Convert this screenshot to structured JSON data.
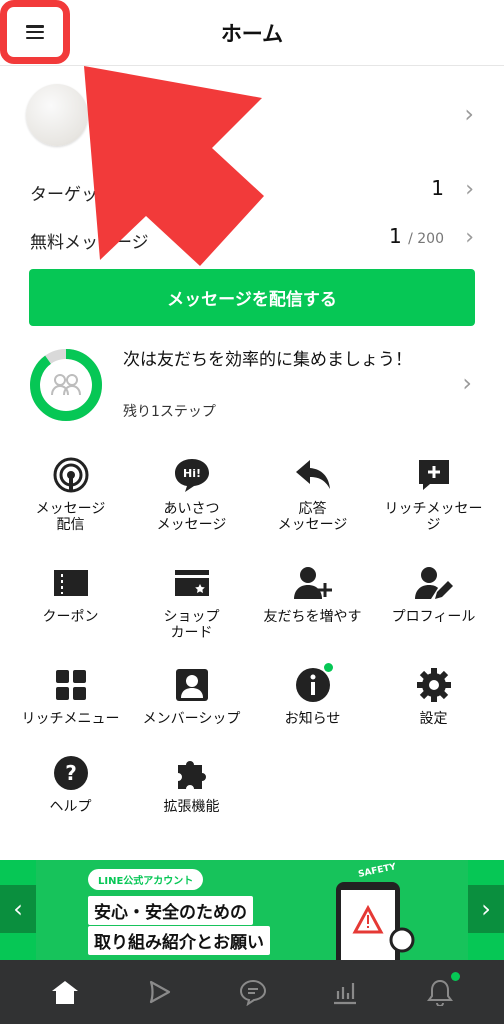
{
  "header": {
    "title": "ホーム"
  },
  "stats": [
    {
      "label": "ターゲットリーチ",
      "value": "1",
      "suffix": ""
    },
    {
      "label": "無料メッセージ",
      "value": "1",
      "suffix": "/ 200"
    }
  ],
  "cta_label": "メッセージを配信する",
  "progress": {
    "text": "次は友だちを効率的に集めましょう！",
    "sub": "残り1ステップ",
    "fraction": 0.9
  },
  "tiles": [
    {
      "label": "メッセージ\n配信",
      "icon": "broadcast-icon"
    },
    {
      "label": "あいさつ\nメッセージ",
      "icon": "greeting-icon"
    },
    {
      "label": "応答\nメッセージ",
      "icon": "reply-icon"
    },
    {
      "label": "リッチメッセー\nジ",
      "icon": "rich-message-icon"
    },
    {
      "label": "クーポン",
      "icon": "coupon-icon"
    },
    {
      "label": "ショップ\nカード",
      "icon": "shop-card-icon"
    },
    {
      "label": "友だちを増やす",
      "icon": "add-friend-icon"
    },
    {
      "label": "プロフィール",
      "icon": "profile-edit-icon"
    },
    {
      "label": "リッチメニュー",
      "icon": "rich-menu-icon"
    },
    {
      "label": "メンバーシップ",
      "icon": "membership-icon"
    },
    {
      "label": "お知らせ",
      "icon": "info-icon"
    },
    {
      "label": "設定",
      "icon": "gear-icon"
    },
    {
      "label": "ヘルプ",
      "icon": "help-icon"
    },
    {
      "label": "拡張機能",
      "icon": "puzzle-icon"
    }
  ],
  "banner": {
    "pill": "LINE公式アカウント",
    "line1": "安心・安全のための",
    "line2": "取り組み紹介とお願い",
    "safety": "SAFETY"
  },
  "tabs": [
    "home-icon",
    "play-icon",
    "chat-icon",
    "chart-icon",
    "bell-icon"
  ],
  "colors": {
    "brand": "#06c755",
    "highlight": "#f23a3a",
    "tabbar": "#313233"
  }
}
